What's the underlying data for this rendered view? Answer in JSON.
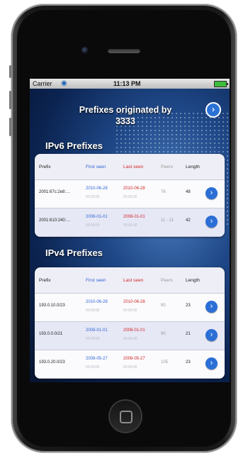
{
  "status_bar": {
    "carrier": "Carrier",
    "time": "11:13 PM"
  },
  "title": "Prefixes originated by 3333",
  "colors": {
    "first_seen": "#2f66d4",
    "last_seen": "#d02626",
    "button": "#2b6fd6"
  },
  "columns": [
    "Prefix",
    "First seen",
    "Last seen",
    "Peers",
    "Length"
  ],
  "ipv6": {
    "heading": "IPv6 Prefixes",
    "rows": [
      {
        "prefix": "2001:67c:2e8:…",
        "first": "2010-06-28",
        "first_time": "00:00:00",
        "last": "2010-06-28",
        "last_time": "00:00:00",
        "peers": "76",
        "length": "48"
      },
      {
        "prefix": "2001:610:240:…",
        "first": "2008-01-01",
        "first_time": "00:00:00",
        "last": "2008-01-01",
        "last_time": "00:00:00",
        "peers": "11 - 21",
        "length": "42"
      }
    ]
  },
  "ipv4": {
    "heading": "IPv4 Prefixes",
    "rows": [
      {
        "prefix": "193.0.10.0/23",
        "first": "2010-06-28",
        "first_time": "00:00:00",
        "last": "2010-06-28",
        "last_time": "00:00:00",
        "peers": "90",
        "length": "23"
      },
      {
        "prefix": "193.0.0.0/21",
        "first": "2008-01-01",
        "first_time": "00:00:00",
        "last": "2008-01-01",
        "last_time": "00:00:00",
        "peers": "90",
        "length": "21"
      },
      {
        "prefix": "193.0.20.0/23",
        "first": "2008-05-27",
        "first_time": "00:00:00",
        "last": "2008-05-27",
        "last_time": "00:00:00",
        "peers": "105",
        "length": "23"
      }
    ]
  }
}
